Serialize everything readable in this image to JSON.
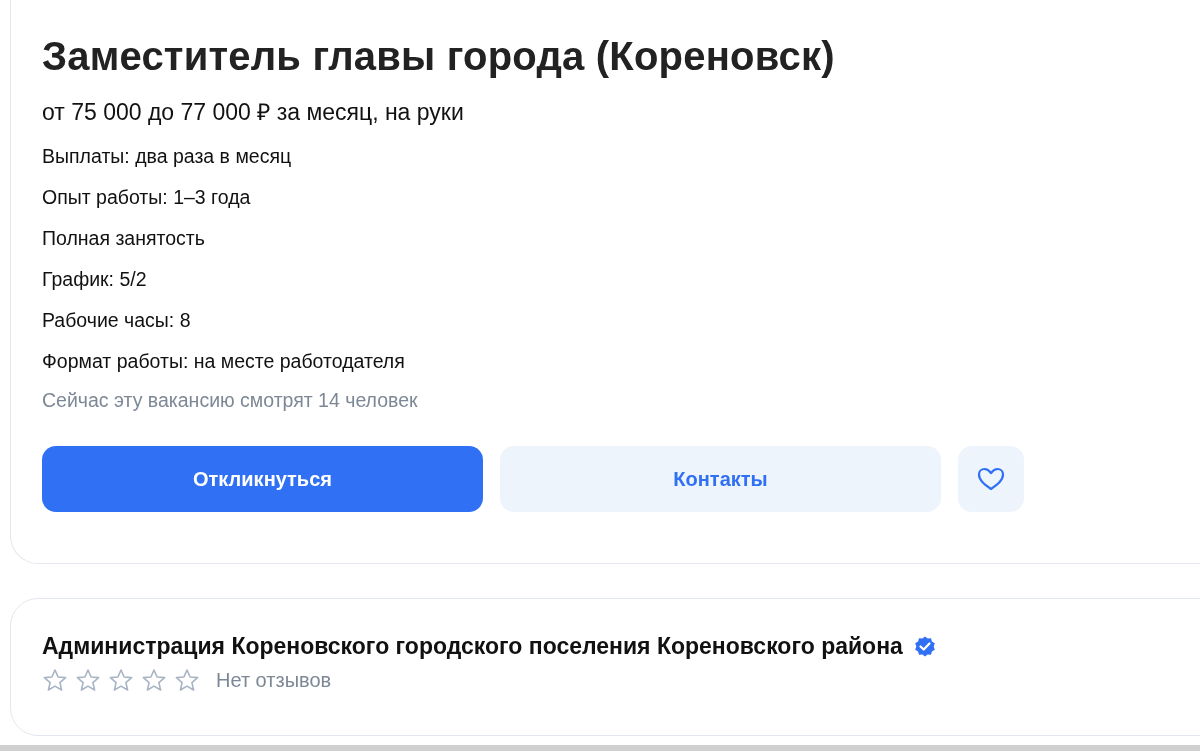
{
  "vacancy": {
    "title": "Заместитель главы города (Кореновск)",
    "salary": "от 75 000 до 77 000 ₽ за месяц, на руки",
    "details": [
      "Выплаты: два раза в месяц",
      "Опыт работы: 1–3 года",
      "Полная занятость",
      "График: 5/2",
      "Рабочие часы: 8",
      "Формат работы: на месте работодателя"
    ],
    "viewers": "Сейчас эту вакансию смотрят 14 человек",
    "buttons": [
      {
        "kind": "primary",
        "label": "Откликнуться"
      },
      {
        "kind": "secondary",
        "label": "Контакты"
      }
    ],
    "favorite": false
  },
  "employer": {
    "name": "Администрация Кореновского городского поселения Кореновского района",
    "verified": true,
    "stars": 0,
    "reviews": "Нет отзывов"
  }
}
